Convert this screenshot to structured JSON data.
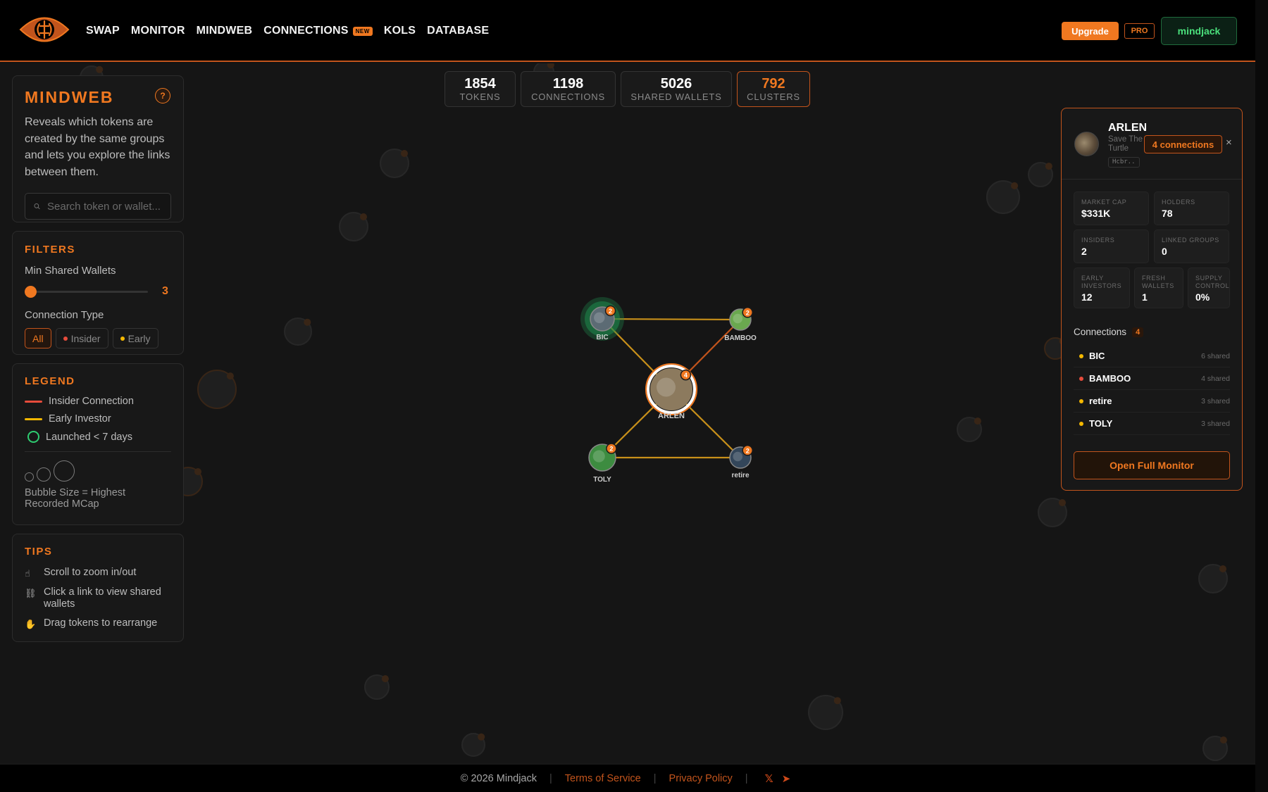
{
  "nav": {
    "links": [
      "SWAP",
      "MONITOR",
      "MINDWEB",
      "CONNECTIONS",
      "KOLS",
      "DATABASE"
    ],
    "new_badge": "NEW",
    "upgrade_label": "Upgrade",
    "pro_label": "PRO",
    "user_label": "mindjack"
  },
  "stats": [
    {
      "value": "1854",
      "label": "TOKENS"
    },
    {
      "value": "1198",
      "label": "CONNECTIONS"
    },
    {
      "value": "5026",
      "label": "SHARED WALLETS"
    },
    {
      "value": "792",
      "label": "CLUSTERS"
    }
  ],
  "mindweb": {
    "title": "MINDWEB",
    "help_icon": "?",
    "description": "Reveals which tokens are created by the same groups and lets you explore the links between them.",
    "search_placeholder": "Search token or wallet..."
  },
  "filters": {
    "title": "FILTERS",
    "min_shared_label": "Min Shared Wallets",
    "min_shared_value": "3",
    "slider_fraction": 0,
    "connection_type_label": "Connection Type",
    "types": [
      "All",
      "Insider",
      "Early"
    ],
    "active_type": "All"
  },
  "legend": {
    "title": "LEGEND",
    "insider": "Insider Connection",
    "early": "Early Investor",
    "launched": "Launched < 7 days",
    "bubble_size": "Bubble Size = Highest Recorded MCap"
  },
  "tips": {
    "title": "TIPS",
    "items": [
      {
        "icon": "scroll-icon",
        "text": "Scroll to zoom in/out"
      },
      {
        "icon": "link-icon",
        "text": "Click a link to view shared wallets"
      },
      {
        "icon": "hand-icon",
        "text": "Drag tokens to rearrange"
      }
    ]
  },
  "graph": {
    "nodes": [
      {
        "id": "BIC",
        "badge": "2",
        "launched_recent": true
      },
      {
        "id": "BAMBOO",
        "badge": "2",
        "launched_recent": false
      },
      {
        "id": "ARLEN",
        "badge": "4",
        "selected": true
      },
      {
        "id": "TOLY",
        "badge": "2",
        "launched_recent": false
      },
      {
        "id": "retire",
        "badge": "2",
        "launched_recent": false
      }
    ],
    "edges": [
      {
        "from": "BIC",
        "to": "BAMBOO",
        "type": "early"
      },
      {
        "from": "BIC",
        "to": "ARLEN",
        "type": "early"
      },
      {
        "from": "BAMBOO",
        "to": "ARLEN",
        "type": "insider"
      },
      {
        "from": "ARLEN",
        "to": "TOLY",
        "type": "early"
      },
      {
        "from": "ARLEN",
        "to": "retire",
        "type": "early"
      },
      {
        "from": "TOLY",
        "to": "retire",
        "type": "early"
      }
    ]
  },
  "detail": {
    "name": "ARLEN",
    "subtitle": "Save The Turtle",
    "address": "Hcbr..",
    "connections_label": "4 connections",
    "close_icon": "×",
    "metrics": [
      {
        "label": "MARKET CAP",
        "value": "$331K"
      },
      {
        "label": "HOLDERS",
        "value": "78"
      },
      {
        "label": "INSIDERS",
        "value": "2"
      },
      {
        "label": "LINKED GROUPS",
        "value": "0"
      },
      {
        "label": "EARLY INVESTORS",
        "value": "12"
      },
      {
        "label": "FRESH WALLETS",
        "value": "1"
      },
      {
        "label": "SUPPLY CONTROL",
        "value": "0%"
      }
    ],
    "connections_title": "Connections",
    "connections_count": "4",
    "connections": [
      {
        "name": "BIC",
        "shared": "6 shared",
        "color": "#f5b800"
      },
      {
        "name": "BAMBOO",
        "shared": "4 shared",
        "color": "#e74c3c"
      },
      {
        "name": "retire",
        "shared": "3 shared",
        "color": "#f5b800"
      },
      {
        "name": "TOLY",
        "shared": "3 shared",
        "color": "#f5b800"
      }
    ],
    "open_label": "Open Full Monitor"
  },
  "footer": {
    "copyright": "© 2026 Mindjack",
    "terms": "Terms of Service",
    "privacy": "Privacy Policy",
    "x_icon": "𝕏",
    "telegram_icon": "➤"
  },
  "colors": {
    "accent": "#f07820",
    "insider": "#e74c3c",
    "early": "#f5b800",
    "launched": "#2ecc71"
  }
}
